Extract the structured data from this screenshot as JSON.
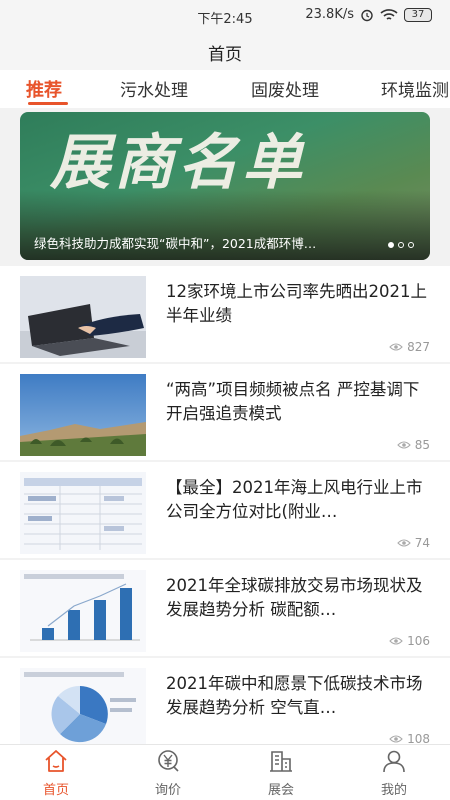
{
  "status_bar": {
    "time": "下午2:45",
    "speed": "23.8K/s",
    "battery": "37"
  },
  "header": {
    "title": "首页"
  },
  "tabs": [
    {
      "label": "推荐",
      "active": true
    },
    {
      "label": "污水处理"
    },
    {
      "label": "固废处理"
    },
    {
      "label": "环境监测"
    }
  ],
  "banner": {
    "headline_image_text": "展商名单",
    "caption": "绿色科技助力成都实现“碳中和”，2021成都环博…",
    "slides": 3,
    "current_slide": 1
  },
  "articles": [
    {
      "title": "12家环境上市公司率先晒出2021上半年业绩",
      "views": "827"
    },
    {
      "title": "“两高”项目频频被点名 严控基调下开启强追责模式",
      "views": "85"
    },
    {
      "title": "【最全】2021年海上风电行业上市公司全方位对比(附业…",
      "views": "74"
    },
    {
      "title": "2021年全球碳排放交易市场现状及发展趋势分析 碳配额…",
      "views": "106"
    },
    {
      "title": "2021年碳中和愿景下低碳技术市场发展趋势分析 空气直…",
      "views": "108"
    }
  ],
  "bottom_nav": [
    {
      "label": "首页",
      "icon": "home-icon",
      "active": true
    },
    {
      "label": "询价",
      "icon": "yuan-icon"
    },
    {
      "label": "展会",
      "icon": "building-icon"
    },
    {
      "label": "我的",
      "icon": "user-icon"
    }
  ],
  "colors": {
    "accent": "#e8542b"
  }
}
